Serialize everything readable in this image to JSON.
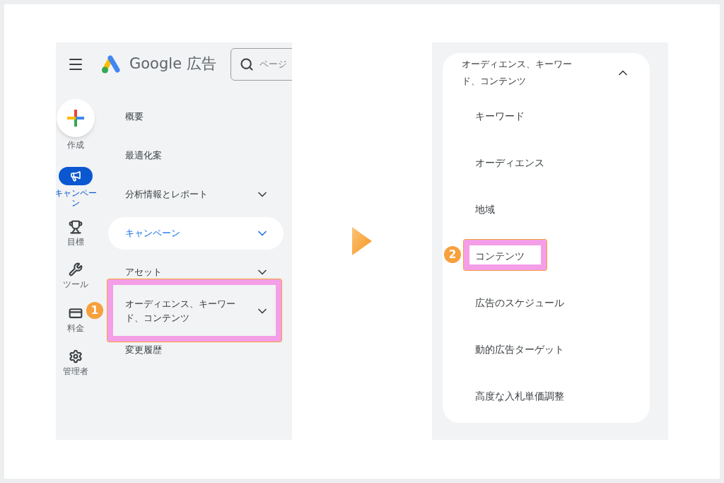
{
  "left_screen": {
    "header": {
      "product_name": "Google 広告",
      "search": {
        "placeholder": "ページ"
      }
    },
    "rail": [
      {
        "label": "作成",
        "kind": "create",
        "selected": false
      },
      {
        "label": "キャンペーン",
        "kind": "campaigns",
        "selected": true
      },
      {
        "label": "目標",
        "kind": "goals",
        "selected": false
      },
      {
        "label": "ツール",
        "kind": "tools",
        "selected": false
      },
      {
        "label": "料金",
        "kind": "billing",
        "selected": false
      },
      {
        "label": "管理者",
        "kind": "admin",
        "selected": false
      }
    ],
    "nav": [
      {
        "label": "概要",
        "kind": "link",
        "selected": false
      },
      {
        "label": "最適化案",
        "kind": "link",
        "selected": false
      },
      {
        "label": "分析情報とレポート",
        "kind": "group",
        "selected": false,
        "expanded": false
      },
      {
        "label": "キャンペーン",
        "kind": "group",
        "selected": true,
        "expanded": false
      },
      {
        "label": "アセット",
        "kind": "group",
        "selected": false,
        "expanded": false
      },
      {
        "label": "オーディエンス、キーワード、コンテンツ",
        "kind": "group",
        "selected": false,
        "expanded": false,
        "callout": "1"
      },
      {
        "label": "変更履歴",
        "kind": "link",
        "selected": false
      }
    ]
  },
  "right_screen": {
    "group": {
      "label": "オーディエンス、キーワード、コンテンツ",
      "expanded": true
    },
    "items": [
      {
        "label": "キーワード"
      },
      {
        "label": "オーディエンス"
      },
      {
        "label": "地域"
      },
      {
        "label": "コンテンツ",
        "callout": "2"
      },
      {
        "label": "広告のスケジュール"
      },
      {
        "label": "動的広告ターゲット"
      },
      {
        "label": "高度な入札単価調整"
      }
    ]
  }
}
